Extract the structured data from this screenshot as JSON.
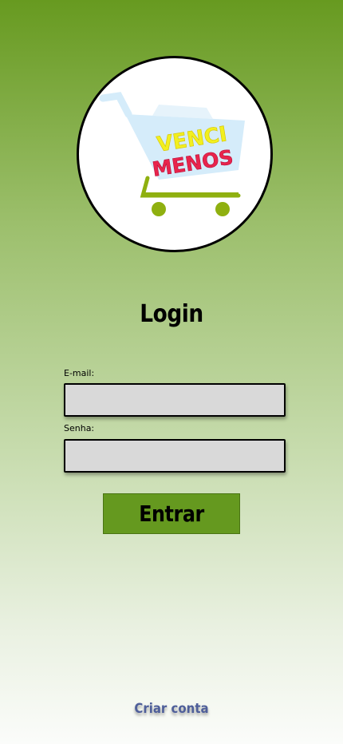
{
  "logo": {
    "text_line1": "VENCI",
    "text_line2": "MENOS",
    "colors": {
      "line1": "#f2ef1f",
      "line2": "#e8244c",
      "basket": "#d5ecfa",
      "cart_frame": "#8fb010"
    }
  },
  "login": {
    "title": "Login",
    "email_label": "E-mail:",
    "email_value": "",
    "password_label": "Senha:",
    "password_value": "",
    "submit_label": "Entrar",
    "create_account_label": "Criar conta"
  },
  "colors": {
    "accent_green": "#65991f",
    "input_bg": "#d9d9d9",
    "link": "#4f5f9a"
  }
}
